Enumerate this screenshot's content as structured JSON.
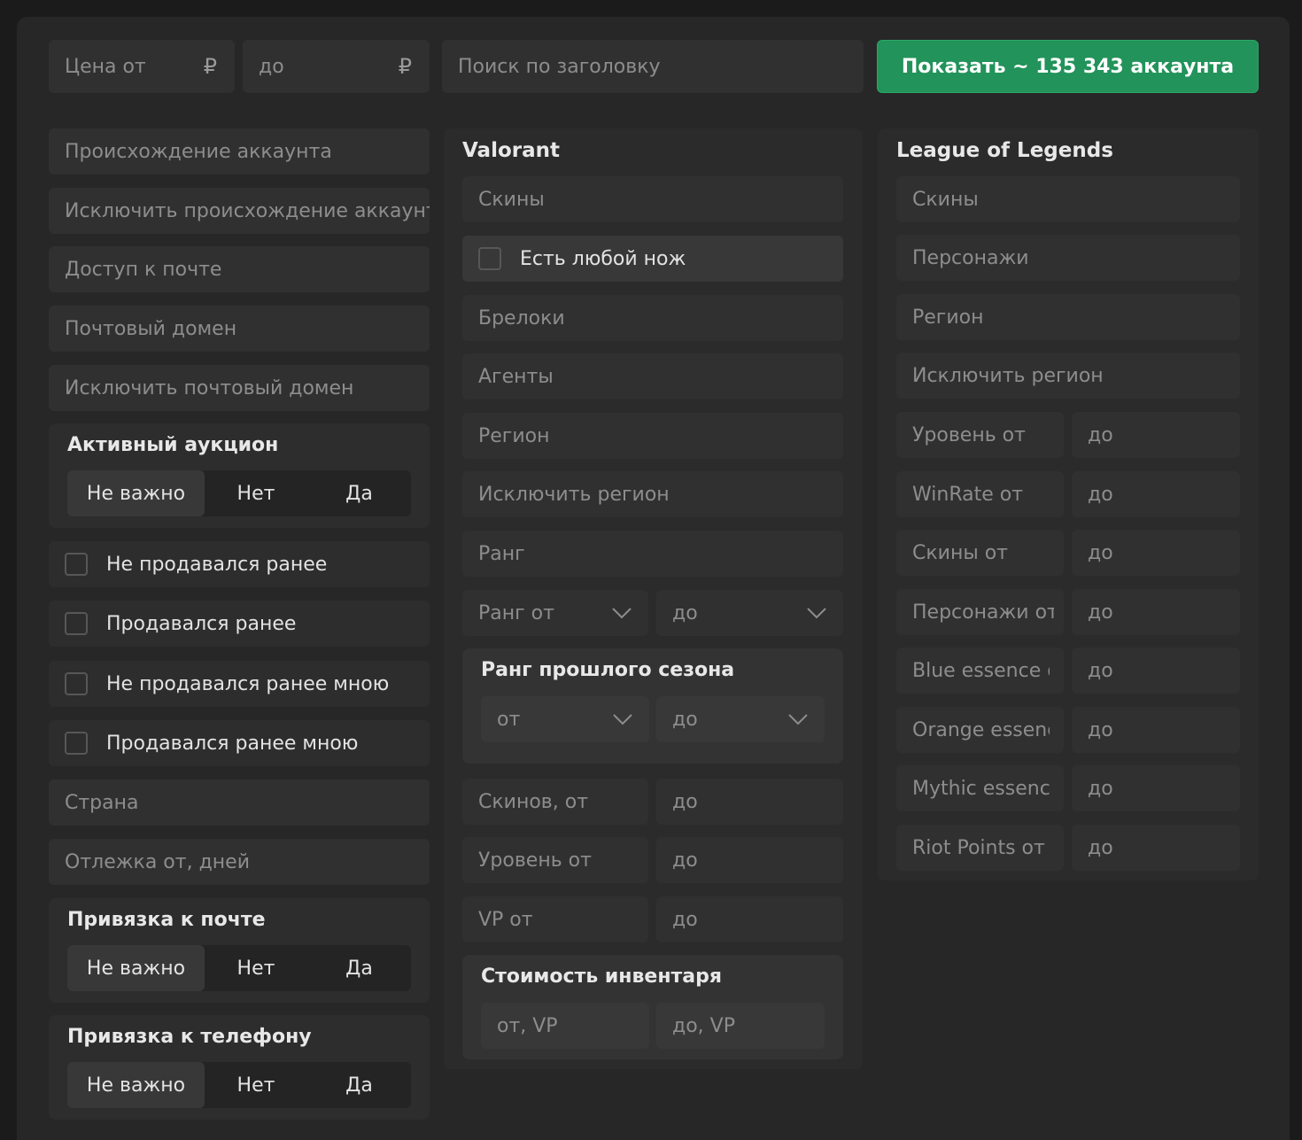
{
  "top": {
    "price_from_placeholder": "Цена от",
    "price_to_placeholder": "до",
    "currency_symbol": "₽",
    "search_placeholder": "Поиск по заголовку",
    "show_button_label": "Показать ~ 135 343 аккаунта",
    "show_button_color": "#22935a"
  },
  "left": {
    "origin_placeholder": "Происхождение аккаунта",
    "exclude_origin_placeholder": "Исключить происхождение аккаунта",
    "email_access_placeholder": "Доступ к почте",
    "email_domain_placeholder": "Почтовый домен",
    "exclude_email_domain_placeholder": "Исключить почтовый домен",
    "auction": {
      "title": "Активный аукцион",
      "options": [
        "Не важно",
        "Нет",
        "Да"
      ],
      "selected": "Не важно"
    },
    "checkboxes": [
      {
        "label": "Не продавался ранее",
        "checked": false
      },
      {
        "label": "Продавался ранее",
        "checked": false
      },
      {
        "label": "Не продавался ранее мною",
        "checked": false
      },
      {
        "label": "Продавался ранее мною",
        "checked": false
      }
    ],
    "country_placeholder": "Страна",
    "inactive_days_placeholder": "Отлежка от, дней",
    "email_binding": {
      "title": "Привязка к почте",
      "options": [
        "Не важно",
        "Нет",
        "Да"
      ],
      "selected": "Не важно"
    },
    "phone_binding": {
      "title": "Привязка к телефону",
      "options": [
        "Не важно",
        "Нет",
        "Да"
      ],
      "selected": "Не важно"
    }
  },
  "valorant": {
    "title": "Valorant",
    "skins_placeholder": "Скины",
    "any_knife_label": "Есть любой нож",
    "any_knife_checked": false,
    "charms_placeholder": "Брелоки",
    "agents_placeholder": "Агенты",
    "region_placeholder": "Регион",
    "exclude_region_placeholder": "Исключить регион",
    "rank_placeholder": "Ранг",
    "rank_from_placeholder": "Ранг от",
    "rank_to_placeholder": "до",
    "last_season": {
      "title": "Ранг прошлого сезона",
      "from_placeholder": "от",
      "to_placeholder": "до"
    },
    "skins_from_placeholder": "Скинов, от",
    "skins_to_placeholder": "до",
    "level_from_placeholder": "Уровень от",
    "level_to_placeholder": "до",
    "vp_from_placeholder": "VP от",
    "vp_to_placeholder": "до",
    "inventory": {
      "title": "Стоимость инвентаря",
      "from_placeholder": "от, VP",
      "to_placeholder": "до, VP"
    }
  },
  "lol": {
    "title": "League of Legends",
    "skins_placeholder": "Скины",
    "champions_placeholder": "Персонажи",
    "region_placeholder": "Регион",
    "exclude_region_placeholder": "Исключить регион",
    "ranges": [
      {
        "from": "Уровень от",
        "to": "до"
      },
      {
        "from": "WinRate от",
        "to": "до"
      },
      {
        "from": "Скины от",
        "to": "до"
      },
      {
        "from": "Персонажи от",
        "to": "до"
      },
      {
        "from": "Blue essence от",
        "to": "до"
      },
      {
        "from": "Orange essence от",
        "to": "до"
      },
      {
        "from": "Mythic essence от",
        "to": "до"
      },
      {
        "from": "Riot Points от",
        "to": "до"
      }
    ]
  }
}
